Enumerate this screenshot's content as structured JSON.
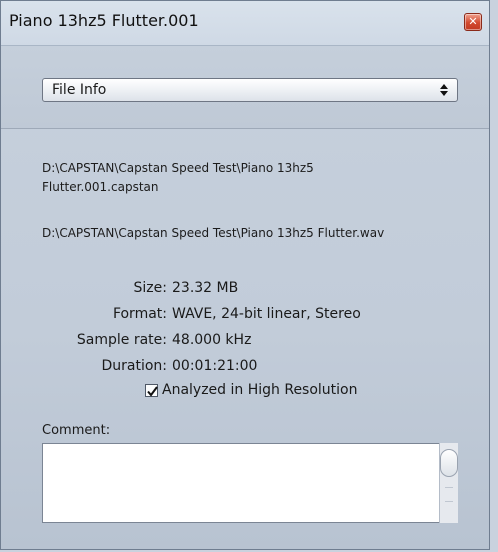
{
  "window": {
    "title": "Piano 13hz5 Flutter.001"
  },
  "panel_select": {
    "selected": "File Info"
  },
  "paths": [
    "D:\\CAPSTAN\\Capstan Speed Test\\Piano 13hz5 Flutter.001.capstan",
    "D:\\CAPSTAN\\Capstan Speed Test\\Piano 13hz5 Flutter.wav"
  ],
  "info": [
    {
      "label": "Size:",
      "value": "23.32 MB"
    },
    {
      "label": "Format:",
      "value": "WAVE, 24-bit linear, Stereo"
    },
    {
      "label": "Sample rate:",
      "value": "48.000 kHz"
    },
    {
      "label": "Duration:",
      "value": "00:01:21:00"
    }
  ],
  "analyzed": {
    "label": "Analyzed in High Resolution",
    "checked": true
  },
  "comment": {
    "label": "Comment:",
    "value": ""
  },
  "icons": {
    "close": "close-icon",
    "select_arrows": "up-down-arrows-icon",
    "check": "checkmark-icon"
  }
}
